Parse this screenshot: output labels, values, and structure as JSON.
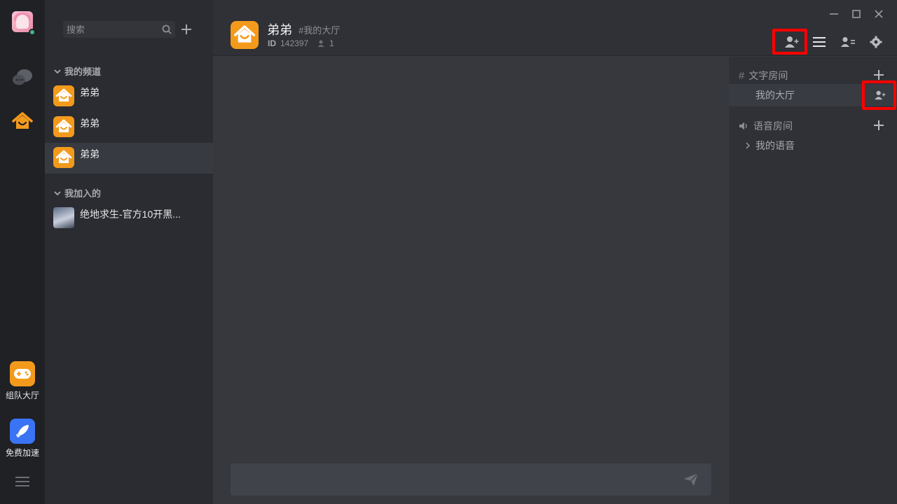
{
  "rail": {
    "apps": [
      {
        "label": "组队大厅",
        "color": "#f39a1c"
      },
      {
        "label": "免费加速",
        "color": "#3b73f5"
      }
    ]
  },
  "channel_list": {
    "search_placeholder": "搜索",
    "sections": [
      {
        "title": "我的频道",
        "items": [
          "弟弟",
          "弟弟",
          "弟弟"
        ]
      },
      {
        "title": "我加入的",
        "items": [
          "绝地求生-官方10开黑..."
        ]
      }
    ]
  },
  "header": {
    "title": "弟弟",
    "channel_tag": "#我的大厅",
    "id_label": "ID",
    "id_value": "142397",
    "member_count": "1"
  },
  "rooms": {
    "text_section": "文字房间",
    "text_rooms": [
      "我的大厅"
    ],
    "voice_section": "语音房间",
    "voice_rooms": [
      "我的语音"
    ]
  },
  "colors": {
    "accent": "#f39a1c",
    "highlight": "#ff0000",
    "online": "#43b581"
  }
}
